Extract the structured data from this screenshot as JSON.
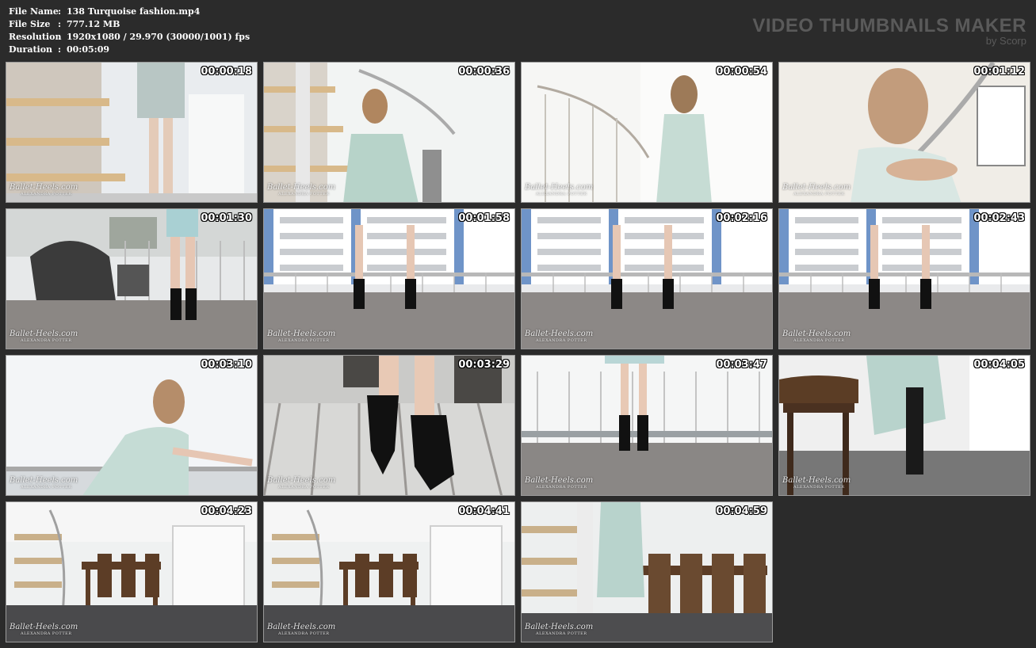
{
  "info": [
    {
      "key": "File Name",
      "sep": ":",
      "value": "138 Turquoise fashion.mp4"
    },
    {
      "key": "File Size",
      "sep": ":",
      "value": "777.12 MB"
    },
    {
      "key": "Resolution",
      "sep": ":",
      "value": "1920x1080 / 29.970 (30000/1001) fps"
    },
    {
      "key": "Duration",
      "sep": ":",
      "value": "00:05:09"
    }
  ],
  "brand": {
    "title": "VIDEO THUMBNAILS MAKER",
    "subtitle": "by Scorp"
  },
  "watermark": {
    "main": "Ballet-Heels.com",
    "sub": "ALEXANDRA POTTER"
  },
  "thumbnails": [
    {
      "time": "00:00:18",
      "scene": "stairs-legs"
    },
    {
      "time": "00:00:36",
      "scene": "stairs-woman"
    },
    {
      "time": "00:00:54",
      "scene": "window-woman"
    },
    {
      "time": "00:01:12",
      "scene": "closeup-face"
    },
    {
      "time": "00:01:30",
      "scene": "balcony-bag"
    },
    {
      "time": "00:01:58",
      "scene": "balcony-building"
    },
    {
      "time": "00:02:16",
      "scene": "balcony-building"
    },
    {
      "time": "00:02:43",
      "scene": "balcony-building"
    },
    {
      "time": "00:03:10",
      "scene": "woman-railing"
    },
    {
      "time": "00:03:29",
      "scene": "boots-closeup"
    },
    {
      "time": "00:03:47",
      "scene": "balcony-boots"
    },
    {
      "time": "00:04:05",
      "scene": "chair-boots"
    },
    {
      "time": "00:04:23",
      "scene": "dining-room"
    },
    {
      "time": "00:04:41",
      "scene": "dining-room"
    },
    {
      "time": "00:04:59",
      "scene": "dining-close"
    }
  ]
}
